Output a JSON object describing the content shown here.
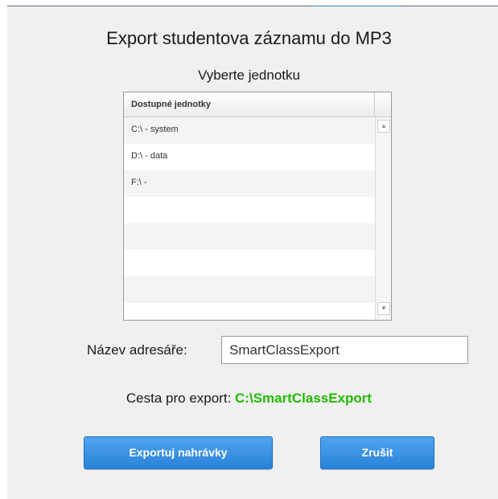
{
  "dialog": {
    "title": "Export studentova záznamu do MP3",
    "subtitle": "Vyberte jednotku"
  },
  "drive_list": {
    "header": "Dostupné jednotky",
    "items": [
      {
        "label": "C:\\ - system"
      },
      {
        "label": "D:\\ - data"
      },
      {
        "label": "F:\\ -"
      },
      {
        "label": ""
      },
      {
        "label": ""
      },
      {
        "label": ""
      },
      {
        "label": ""
      }
    ],
    "scroll_up_icon": "triangle-up-icon",
    "scroll_down_icon": "triangle-down-icon"
  },
  "directory": {
    "label": "Název adresáře:",
    "value": "SmartClassExport"
  },
  "export_path": {
    "label": "Cesta pro export:",
    "value": "C:\\SmartClassExport",
    "value_color": "#22bb00"
  },
  "buttons": {
    "export_label": "Exportuj nahrávky",
    "cancel_label": "Zrušit",
    "color": "#3a92e2"
  }
}
